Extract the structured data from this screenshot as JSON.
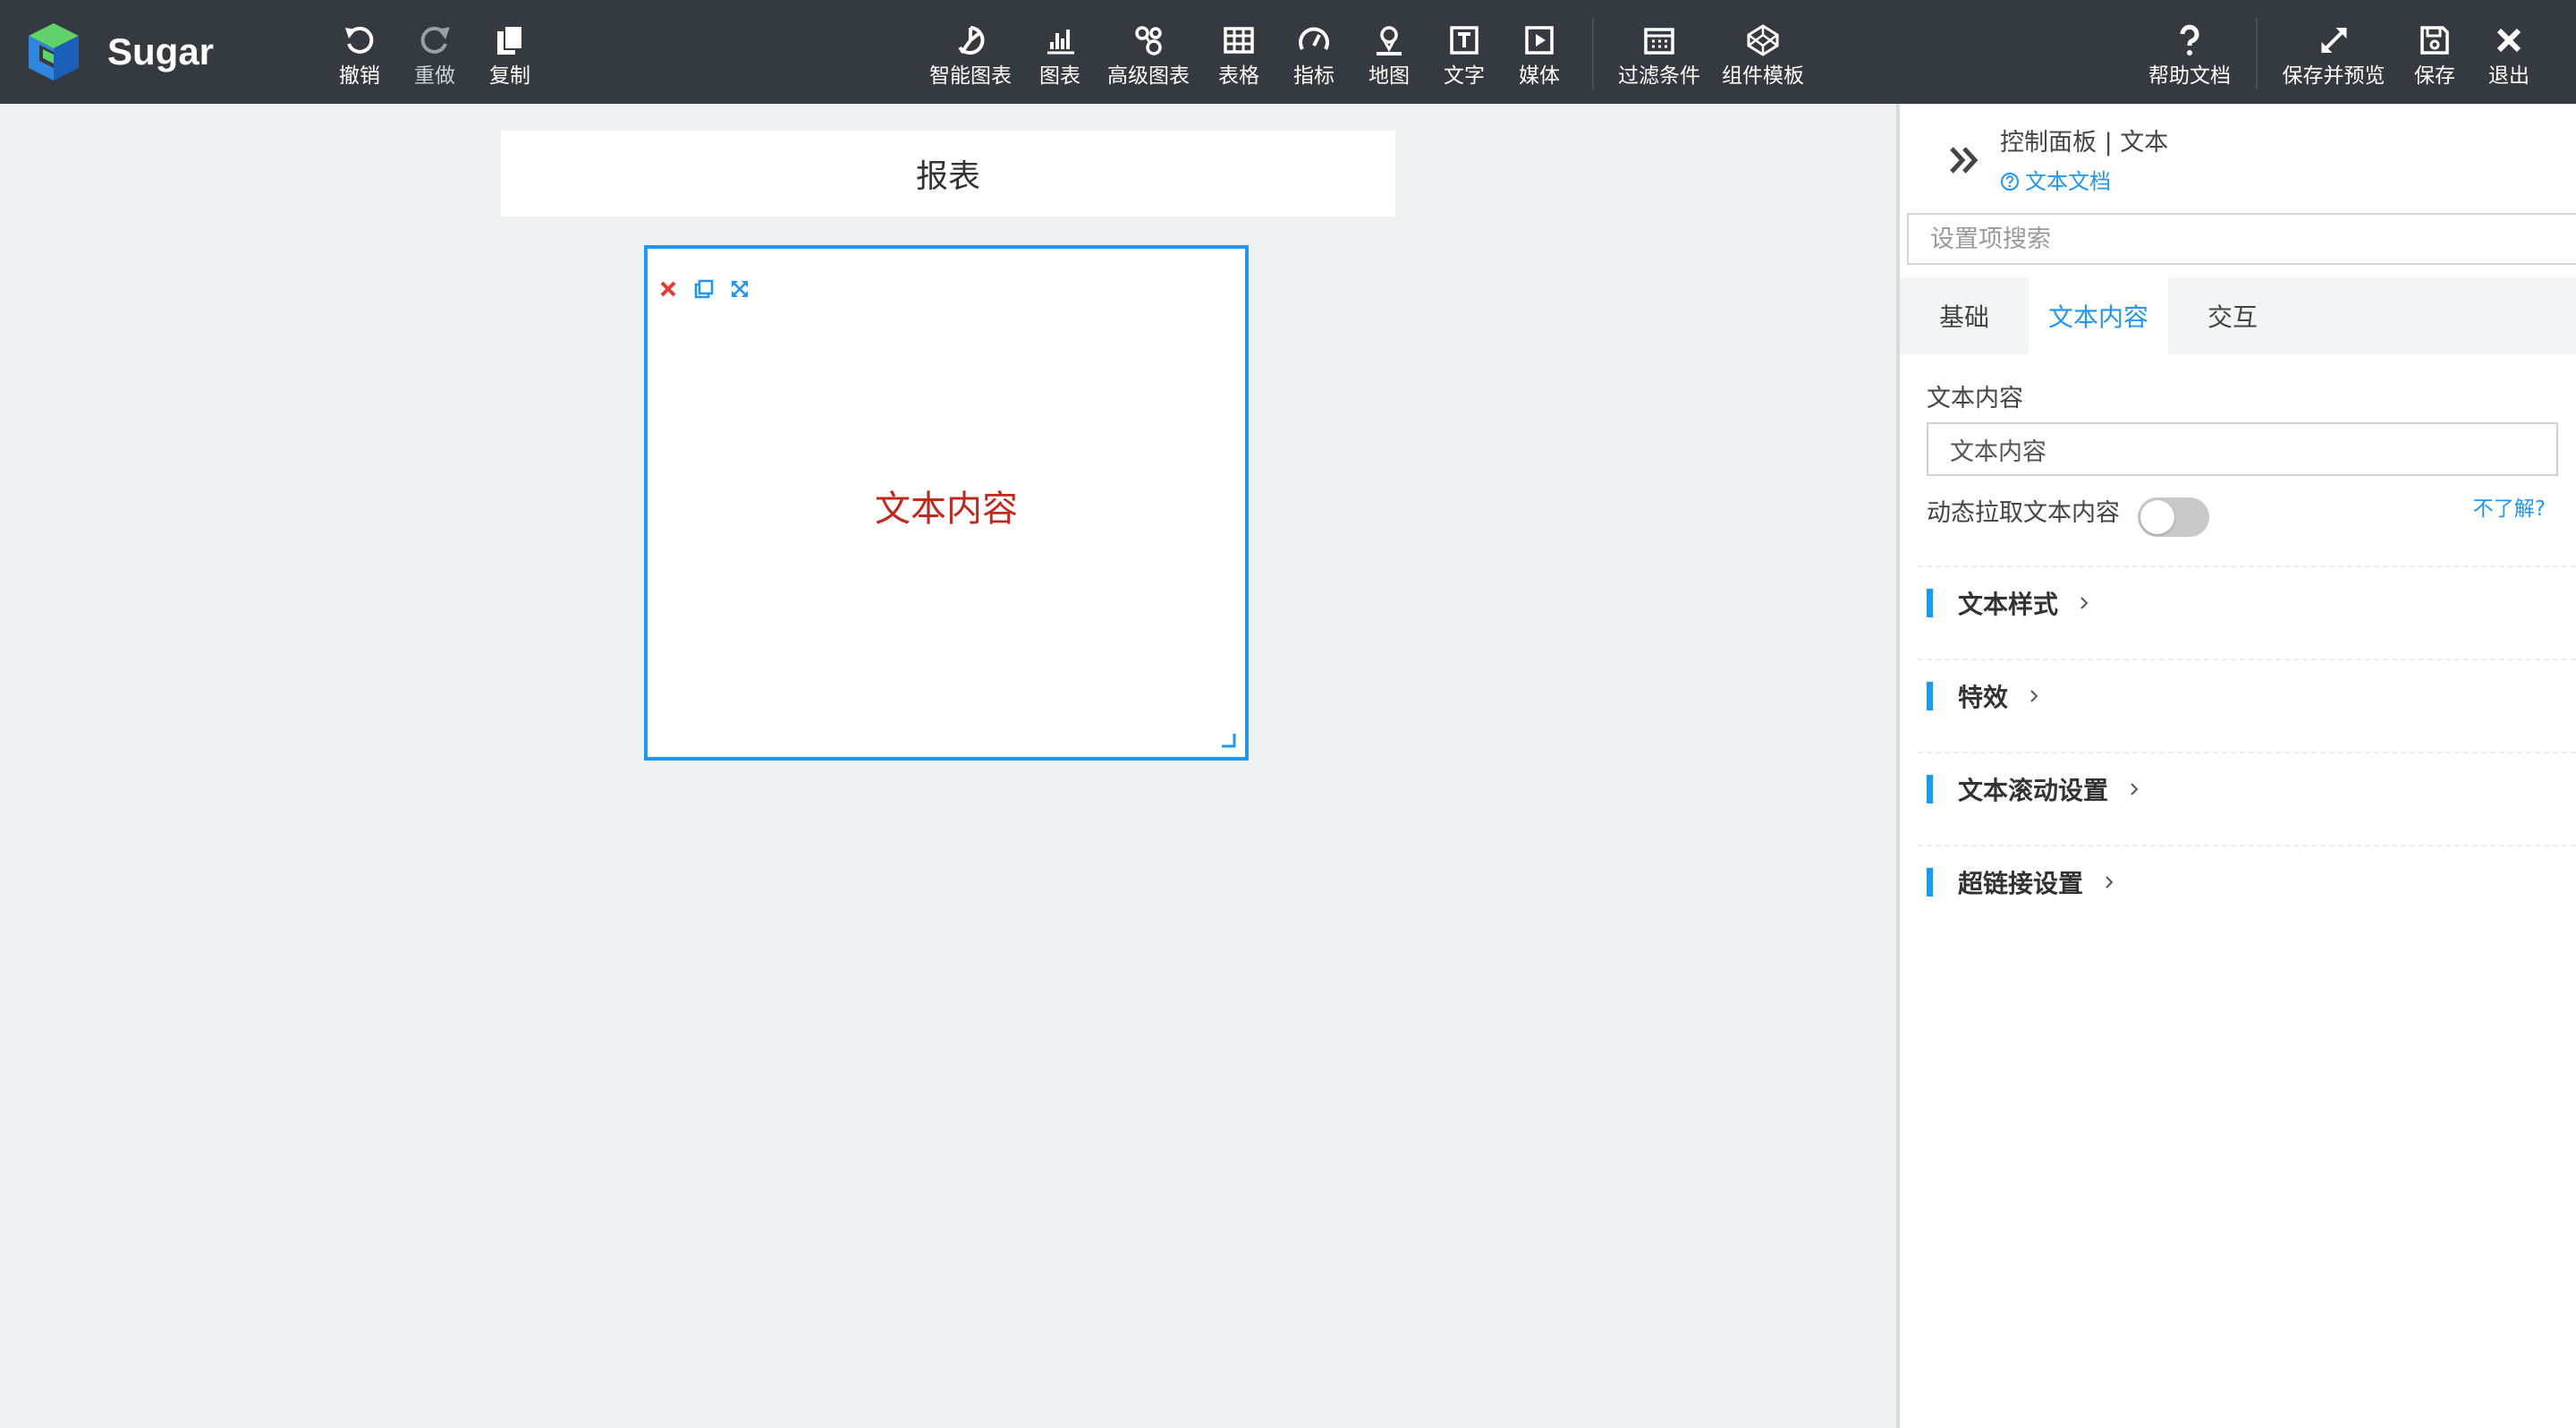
{
  "app": {
    "brand": "Sugar"
  },
  "toolbar": {
    "undo": "撤销",
    "redo": "重做",
    "copy": "复制",
    "smart_chart": "智能图表",
    "chart": "图表",
    "advanced_chart": "高级图表",
    "table": "表格",
    "indicator": "指标",
    "map": "地图",
    "text": "文字",
    "media": "媒体",
    "filter": "过滤条件",
    "component_template": "组件模板",
    "help_doc": "帮助文档",
    "save_preview": "保存并预览",
    "save": "保存",
    "exit": "退出"
  },
  "canvas": {
    "report_title": "报表",
    "widget_text": "文本内容"
  },
  "panel": {
    "title": "控制面板 | 文本",
    "doc_link": "文本文档",
    "search_placeholder": "设置项搜索",
    "tabs": [
      "基础",
      "文本内容",
      "交互"
    ],
    "active_tab": "文本内容",
    "text_content_label": "文本内容",
    "text_content_value": "文本内容",
    "dynamic_label": "动态拉取文本内容",
    "dynamic_enabled": false,
    "help_link": "不了解?",
    "sections": [
      "文本样式",
      "特效",
      "文本滚动设置",
      "超链接设置"
    ]
  },
  "colors": {
    "accent": "#2196f3",
    "toolbar_bg": "#343a40",
    "widget_text": "#c0281e",
    "delete_icon": "#e53935"
  }
}
